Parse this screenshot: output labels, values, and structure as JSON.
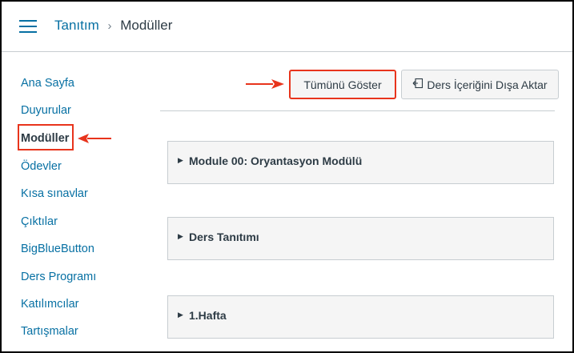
{
  "header": {
    "breadcrumb_course": "Tanıtım",
    "breadcrumb_separator": "›",
    "breadcrumb_current": "Modüller"
  },
  "nav": {
    "items": [
      {
        "label": "Ana Sayfa",
        "active": false
      },
      {
        "label": "Duyurular",
        "active": false
      },
      {
        "label": "Modüller",
        "active": true
      },
      {
        "label": "Ödevler",
        "active": false
      },
      {
        "label": "Kısa sınavlar",
        "active": false
      },
      {
        "label": "Çıktılar",
        "active": false
      },
      {
        "label": "BigBlueButton",
        "active": false
      },
      {
        "label": "Ders Programı",
        "active": false
      },
      {
        "label": "Katılımcılar",
        "active": false
      },
      {
        "label": "Tartışmalar",
        "active": false
      }
    ]
  },
  "toolbar": {
    "show_all_label": "Tümünü Göster",
    "export_label": "Ders İçeriğini Dışa Aktar",
    "export_icon": "export-icon"
  },
  "modules": [
    {
      "title": "Module 00: Oryantasyon Modülü"
    },
    {
      "title": "Ders Tanıtımı"
    },
    {
      "title": "1.Hafta"
    }
  ],
  "colors": {
    "link": "#0770a3",
    "text": "#2d3b45",
    "highlight": "#e8341c",
    "module_bg": "#f5f5f5",
    "border": "#c7cdd1"
  }
}
